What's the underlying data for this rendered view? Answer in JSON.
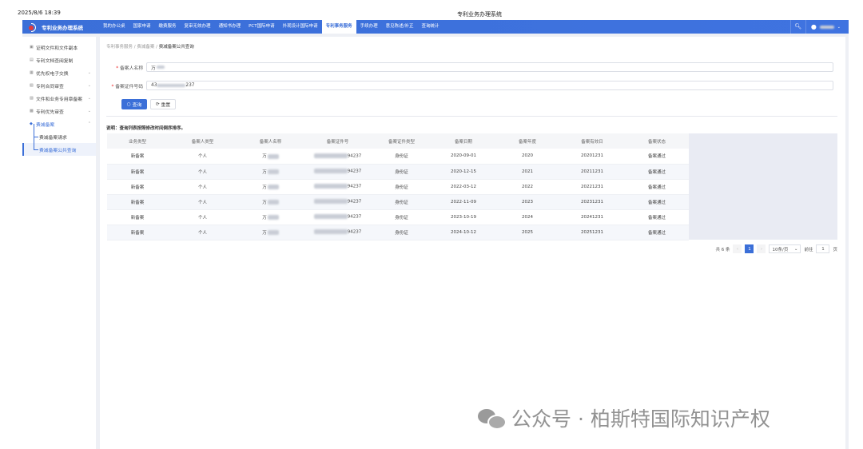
{
  "topbar": {
    "datetime": "2025/8/6 18:39",
    "title": "专利业务办理系统"
  },
  "nav": {
    "logo": "专利业务办理系统",
    "items": [
      "我的办公桌",
      "国家申请",
      "缴费服务",
      "复审无效办理",
      "通知书办理",
      "PCT国际申请",
      "外观设计国际申请",
      "专利事务服务",
      "手续办理",
      "意见陈述/补正",
      "查询统计"
    ],
    "active_index": 7,
    "search_icon": "search-icon",
    "user_icon": "user-icon"
  },
  "sidebar": {
    "items": [
      {
        "label": "证明文件和文件副本",
        "icon": "certificate-icon"
      },
      {
        "label": "专利文档查阅复制",
        "icon": "document-icon"
      },
      {
        "label": "优先权电子交换",
        "icon": "exchange-icon",
        "chevron": "chevron-down"
      },
      {
        "label": "专利合同审查",
        "icon": "contract-icon",
        "chevron": "chevron-down"
      },
      {
        "label": "文件和业务专用章备案",
        "icon": "stamp-icon",
        "chevron": "chevron-down"
      },
      {
        "label": "专利优先审查",
        "icon": "priority-icon",
        "chevron": "chevron-down"
      },
      {
        "label": "费减备案",
        "icon": "fee-icon",
        "chevron": "chevron-up"
      }
    ],
    "subitems": [
      {
        "label": "费减备案请求"
      },
      {
        "label": "费减备案公共查询"
      }
    ]
  },
  "breadcrumb": [
    "专利事务服务",
    "费减备案",
    "费减备案公共查询"
  ],
  "form": {
    "name_label": "备案人名称",
    "name_value": "万",
    "id_label": "备案证件号码",
    "id_prefix": "43",
    "id_suffix": "237",
    "query_button": "查询",
    "reset_button": "重置"
  },
  "note": "说明：查询列表按照修改时间倒序排序。",
  "table": {
    "headers": [
      "业务类型",
      "备案人类型",
      "备案人名称",
      "备案证件号",
      "备案证件类型",
      "备案日期",
      "备案年度",
      "备案有效日",
      "备案状态"
    ],
    "rows": [
      [
        "新备案",
        "个人",
        "万",
        "94237",
        "身份证",
        "2020-09-01",
        "2020",
        "20201231",
        "备案通过"
      ],
      [
        "新备案",
        "个人",
        "万",
        "94237",
        "身份证",
        "2020-12-15",
        "2021",
        "20211231",
        "备案通过"
      ],
      [
        "新备案",
        "个人",
        "万",
        "94237",
        "身份证",
        "2022-03-12",
        "2022",
        "20221231",
        "备案通过"
      ],
      [
        "新备案",
        "个人",
        "万",
        "94237",
        "身份证",
        "2022-11-09",
        "2023",
        "20231231",
        "备案通过"
      ],
      [
        "新备案",
        "个人",
        "万",
        "94237",
        "身份证",
        "2023-10-19",
        "2024",
        "20241231",
        "备案通过"
      ],
      [
        "新备案",
        "个人",
        "万",
        "94237",
        "身份证",
        "2024-10-12",
        "2025",
        "20251231",
        "备案通过"
      ]
    ]
  },
  "pagination": {
    "total": "共 6 条",
    "current_page": "1",
    "page_size": "10条/页",
    "goto_label": "前往",
    "goto_value": "1",
    "page_unit": "页"
  },
  "watermark": "公众号 · 柏斯特国际知识产权"
}
